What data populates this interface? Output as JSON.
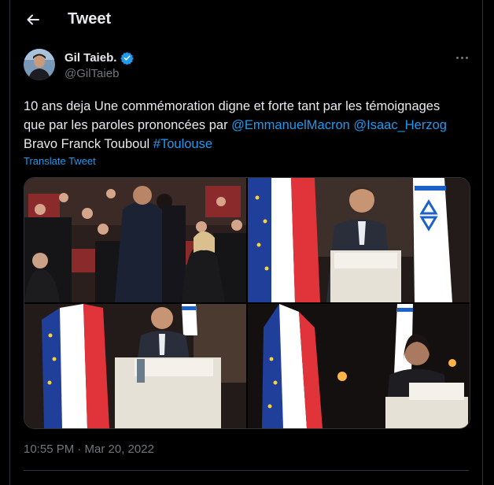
{
  "header": {
    "title": "Tweet",
    "back_icon": "arrow-left-icon"
  },
  "tweet": {
    "author_name": "Gil Taieb.",
    "author_handle": "@GilTaieb",
    "verified_icon": "verified-badge-icon",
    "more_icon": "more-dots-icon",
    "text_line1": "10 ans deja Une commémoration digne et forte tant par les témoignages",
    "text_line2_prefix": "que par les paroles prononcées par ",
    "mention1": "@EmmanuelMacron",
    "mention2": "@Isaac_Herzog",
    "text_line3_prefix": "Bravo Franck Touboul ",
    "hashtag": "#Toulouse",
    "translate_label": "Translate Tweet",
    "timestamp": "10:55 PM · Mar 20, 2022"
  },
  "colors": {
    "background": "#000000",
    "text": "#e7e9ea",
    "secondary_text": "#71767b",
    "link": "#1d9bf0",
    "border": "#2f3336"
  }
}
